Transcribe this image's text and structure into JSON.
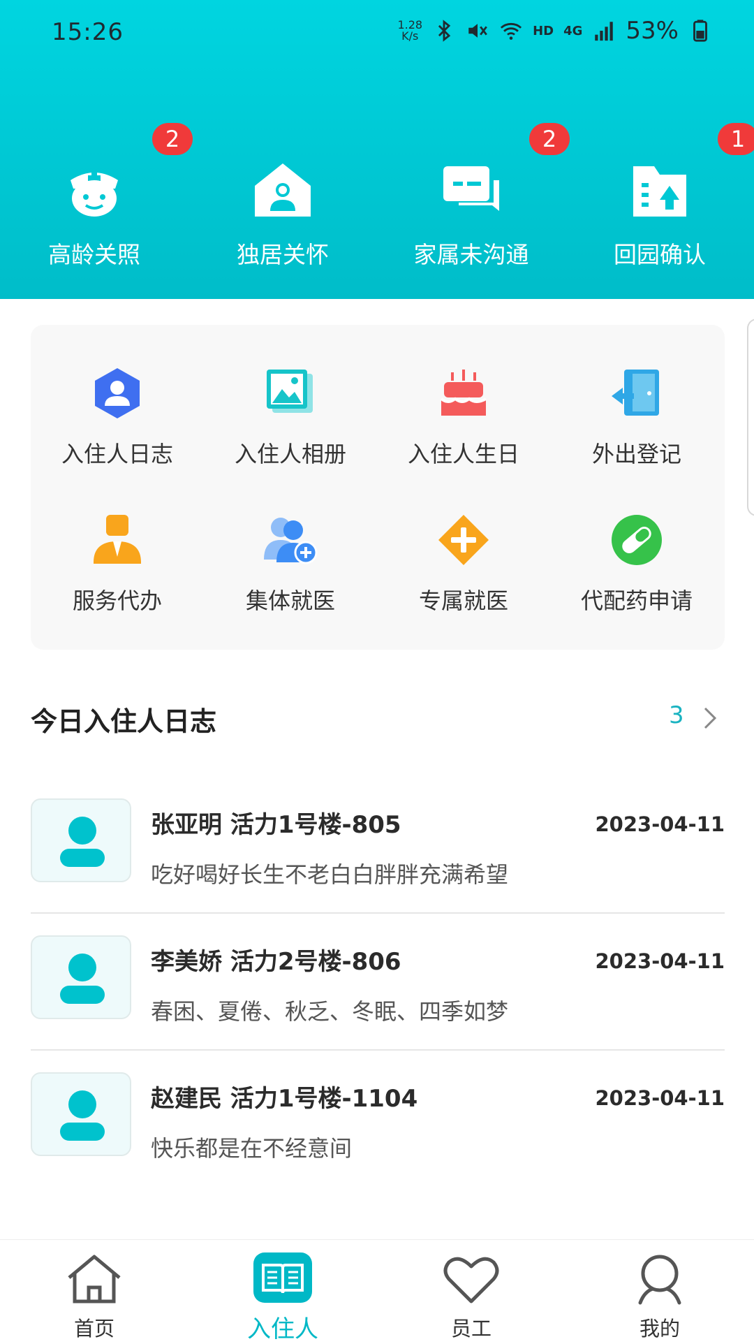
{
  "status_bar": {
    "time": "15:26",
    "net_speed_value": "1.28",
    "net_speed_unit": "K/s",
    "hd": "HD",
    "network": "4G",
    "battery": "53%"
  },
  "quick_actions": [
    {
      "label": "高龄关照",
      "badge": "2",
      "icon": "nurse-icon"
    },
    {
      "label": "独居关怀",
      "badge": "",
      "icon": "home-person-icon"
    },
    {
      "label": "家属未沟通",
      "badge": "2",
      "icon": "chat-icon"
    },
    {
      "label": "回园确认",
      "badge": "1",
      "icon": "building-return-icon"
    }
  ],
  "features": [
    {
      "label": "入住人日志",
      "icon": "resident-log-icon",
      "color": "#3f6ff0"
    },
    {
      "label": "入住人相册",
      "icon": "album-icon",
      "color": "#16c4c9"
    },
    {
      "label": "入住人生日",
      "icon": "birthday-cake-icon",
      "color": "#f45b5b"
    },
    {
      "label": "外出登记",
      "icon": "exit-door-icon",
      "color": "#2fa7e6"
    },
    {
      "label": "服务代办",
      "icon": "service-agent-icon",
      "color": "#f9a51c"
    },
    {
      "label": "集体就医",
      "icon": "group-medical-icon",
      "color": "#3d8df5"
    },
    {
      "label": "专属就医",
      "icon": "medical-cross-icon",
      "color": "#f9a51c"
    },
    {
      "label": "代配药申请",
      "icon": "pill-icon",
      "color": "#36c24a"
    }
  ],
  "section": {
    "title": "今日入住人日志",
    "count": "3"
  },
  "logs": [
    {
      "name": "张亚明 活力1号楼-805",
      "date": "2023-04-11",
      "desc": "吃好喝好长生不老白白胖胖充满希望"
    },
    {
      "name": "李美娇 活力2号楼-806",
      "date": "2023-04-11",
      "desc": "春困、夏倦、秋乏、冬眠、四季如梦"
    },
    {
      "name": "赵建民 活力1号楼-1104",
      "date": "2023-04-11",
      "desc": "快乐都是在不经意间"
    }
  ],
  "nav": {
    "home": "首页",
    "residents": "入住人",
    "staff": "员工",
    "mine": "我的"
  },
  "colors": {
    "header": "#00c8d4",
    "accent": "#00b8c6",
    "badge": "#f03a3a"
  }
}
